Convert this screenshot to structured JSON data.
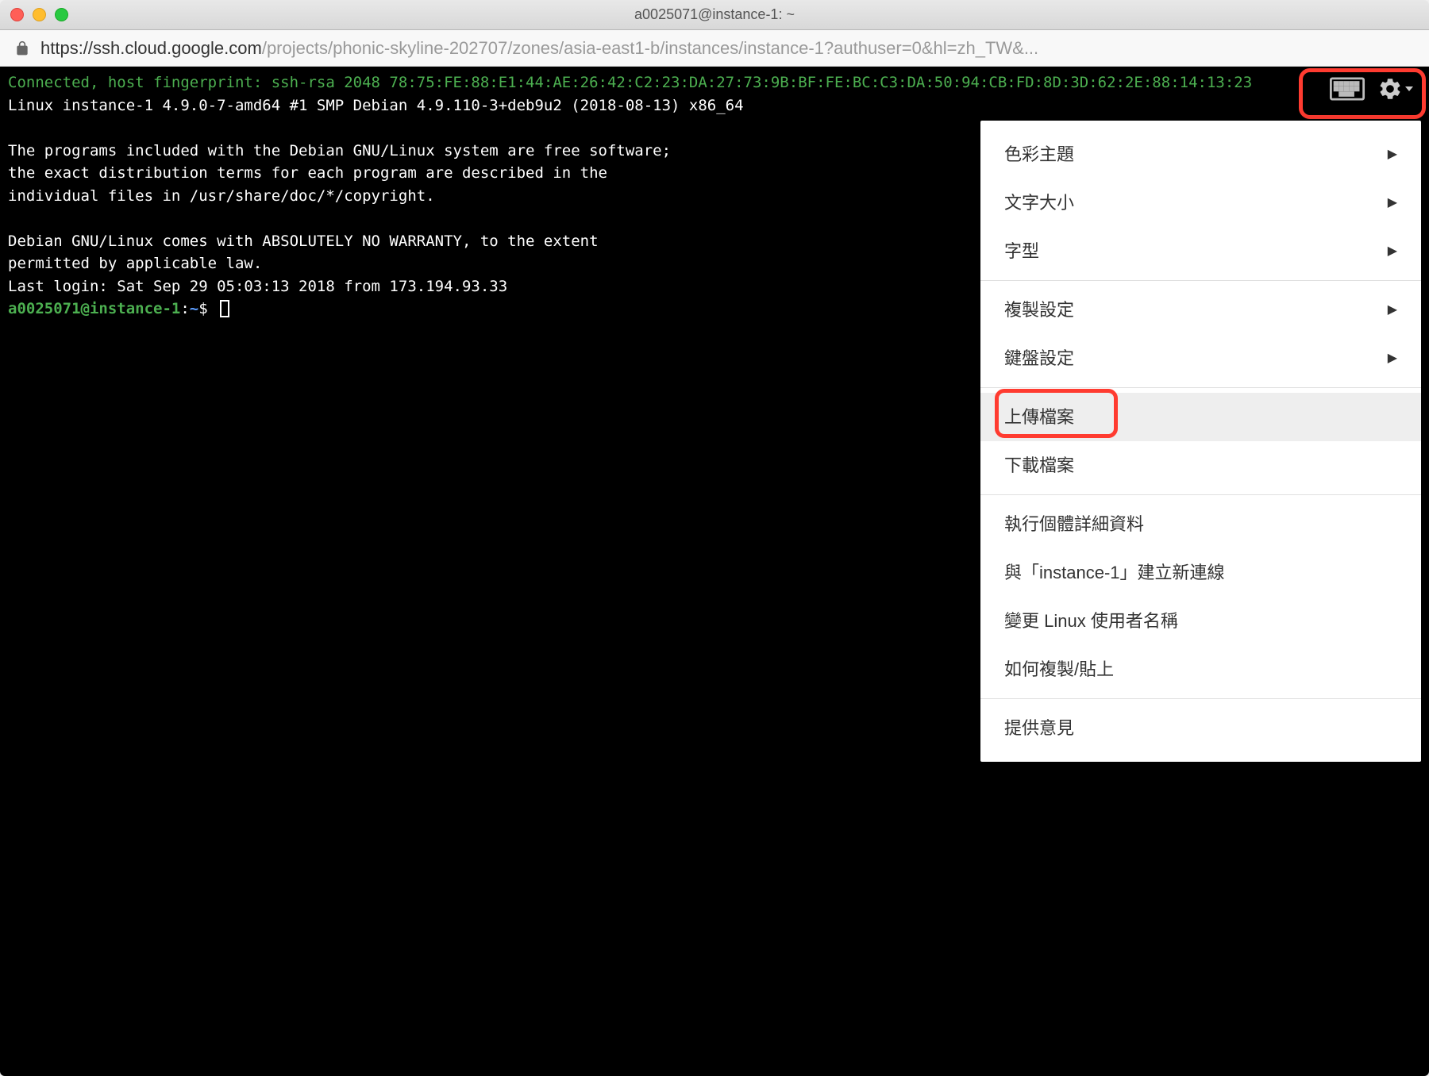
{
  "window": {
    "title": "a0025071@instance-1: ~"
  },
  "url": {
    "host": "https://ssh.cloud.google.com",
    "path": "/projects/phonic-skyline-202707/zones/asia-east1-b/instances/instance-1?authuser=0&hl=zh_TW&..."
  },
  "terminal": {
    "fingerprint_line1": "Connected, host fingerprint: ssh-rsa 2048 78:75:FE:88:E1:44:AE:26:42:C2:23:DA:27:73:9B:BF:FE:BC:C3:DA:50:94:CB:FD:8D:3D:62:2E:88:14:13:23",
    "line_linux": "Linux instance-1 4.9.0-7-amd64 #1 SMP Debian 4.9.110-3+deb9u2 (2018-08-13) x86_64",
    "line_programs_1": "The programs included with the Debian GNU/Linux system are free software;",
    "line_programs_2": "the exact distribution terms for each program are described in the",
    "line_programs_3": "individual files in /usr/share/doc/*/copyright.",
    "line_warranty_1": "Debian GNU/Linux comes with ABSOLUTELY NO WARRANTY, to the extent",
    "line_warranty_2": "permitted by applicable law.",
    "line_lastlogin": "Last login: Sat Sep 29 05:03:13 2018 from 173.194.93.33",
    "prompt_user": "a0025071@instance-1",
    "prompt_colon": ":",
    "prompt_path": "~",
    "prompt_dollar": "$"
  },
  "menu": {
    "items_with_arrow": [
      {
        "label": "色彩主題"
      },
      {
        "label": "文字大小"
      },
      {
        "label": "字型"
      }
    ],
    "items_with_arrow2": [
      {
        "label": "複製設定"
      },
      {
        "label": "鍵盤設定"
      }
    ],
    "upload": "上傳檔案",
    "download": "下載檔案",
    "instance_details": "執行個體詳細資料",
    "new_connection": "與「instance-1」建立新連線",
    "change_username": "變更 Linux 使用者名稱",
    "copy_paste": "如何複製/貼上",
    "feedback": "提供意見"
  }
}
